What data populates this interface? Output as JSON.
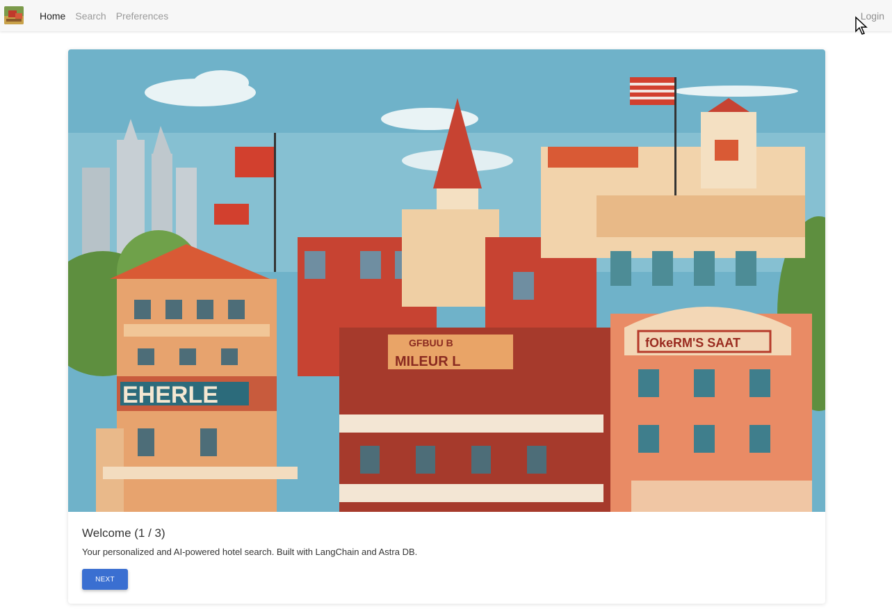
{
  "nav": {
    "logo_icon": "hotel-logo-icon",
    "links": [
      "Home",
      "Search",
      "Preferences"
    ],
    "active": "Home",
    "login": "Login"
  },
  "card": {
    "image_icon": "hotel-illustration",
    "title": "Welcome (1 / 3)",
    "text": "Your personalized and AI-powered hotel search. Built with LangChain and Astra DB.",
    "button": "NEXT"
  },
  "colors": {
    "primary_button": "#3a6fd1",
    "navbar_bg": "#f7f7f7"
  }
}
